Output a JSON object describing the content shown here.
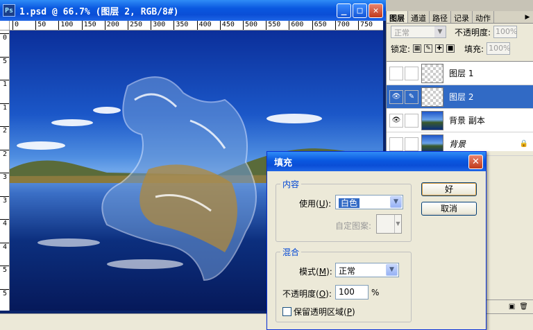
{
  "document": {
    "title": "1.psd @ 66.7% (图层 2, RGB/8#)",
    "ruler_h": [
      "0",
      "50",
      "100",
      "150",
      "200",
      "250",
      "300",
      "350",
      "400",
      "450",
      "500",
      "550",
      "600",
      "650",
      "700",
      "750"
    ],
    "ruler_v": [
      "0",
      "5",
      "1",
      "1",
      "2",
      "2",
      "3",
      "3",
      "4",
      "4",
      "5",
      "5"
    ]
  },
  "layers_panel": {
    "tabs": [
      "图层",
      "通道",
      "路径",
      "记录",
      "动作"
    ],
    "blend_mode": "正常",
    "opacity_label": "不透明度:",
    "opacity_value": "100%",
    "lock_label": "锁定:",
    "fill_label": "填充:",
    "fill_value": "100%",
    "layers": [
      {
        "name": "图层 1",
        "visible": false,
        "selected": false
      },
      {
        "name": "图层 2",
        "visible": true,
        "selected": true
      },
      {
        "name": "背景 副本",
        "visible": true,
        "selected": false
      },
      {
        "name": "背景",
        "visible": false,
        "selected": false,
        "locked": true
      }
    ]
  },
  "fill_dialog": {
    "title": "填充",
    "contents_legend": "内容",
    "use_label": "使用",
    "use_key": "U",
    "use_value": "白色",
    "custom_pattern_label": "自定图案:",
    "blending_legend": "混合",
    "mode_label": "模式",
    "mode_key": "M",
    "mode_value": "正常",
    "opacity_label": "不透明度",
    "opacity_key": "O",
    "opacity_value": "100",
    "opacity_unit": "%",
    "preserve_label": "保留透明区域",
    "preserve_key": "P",
    "ok_label": "好",
    "cancel_label": "取消"
  },
  "colors": {
    "xp_blue": "#0a58e0",
    "selection": "#316ac5",
    "dialog_bg": "#ece9d8"
  }
}
